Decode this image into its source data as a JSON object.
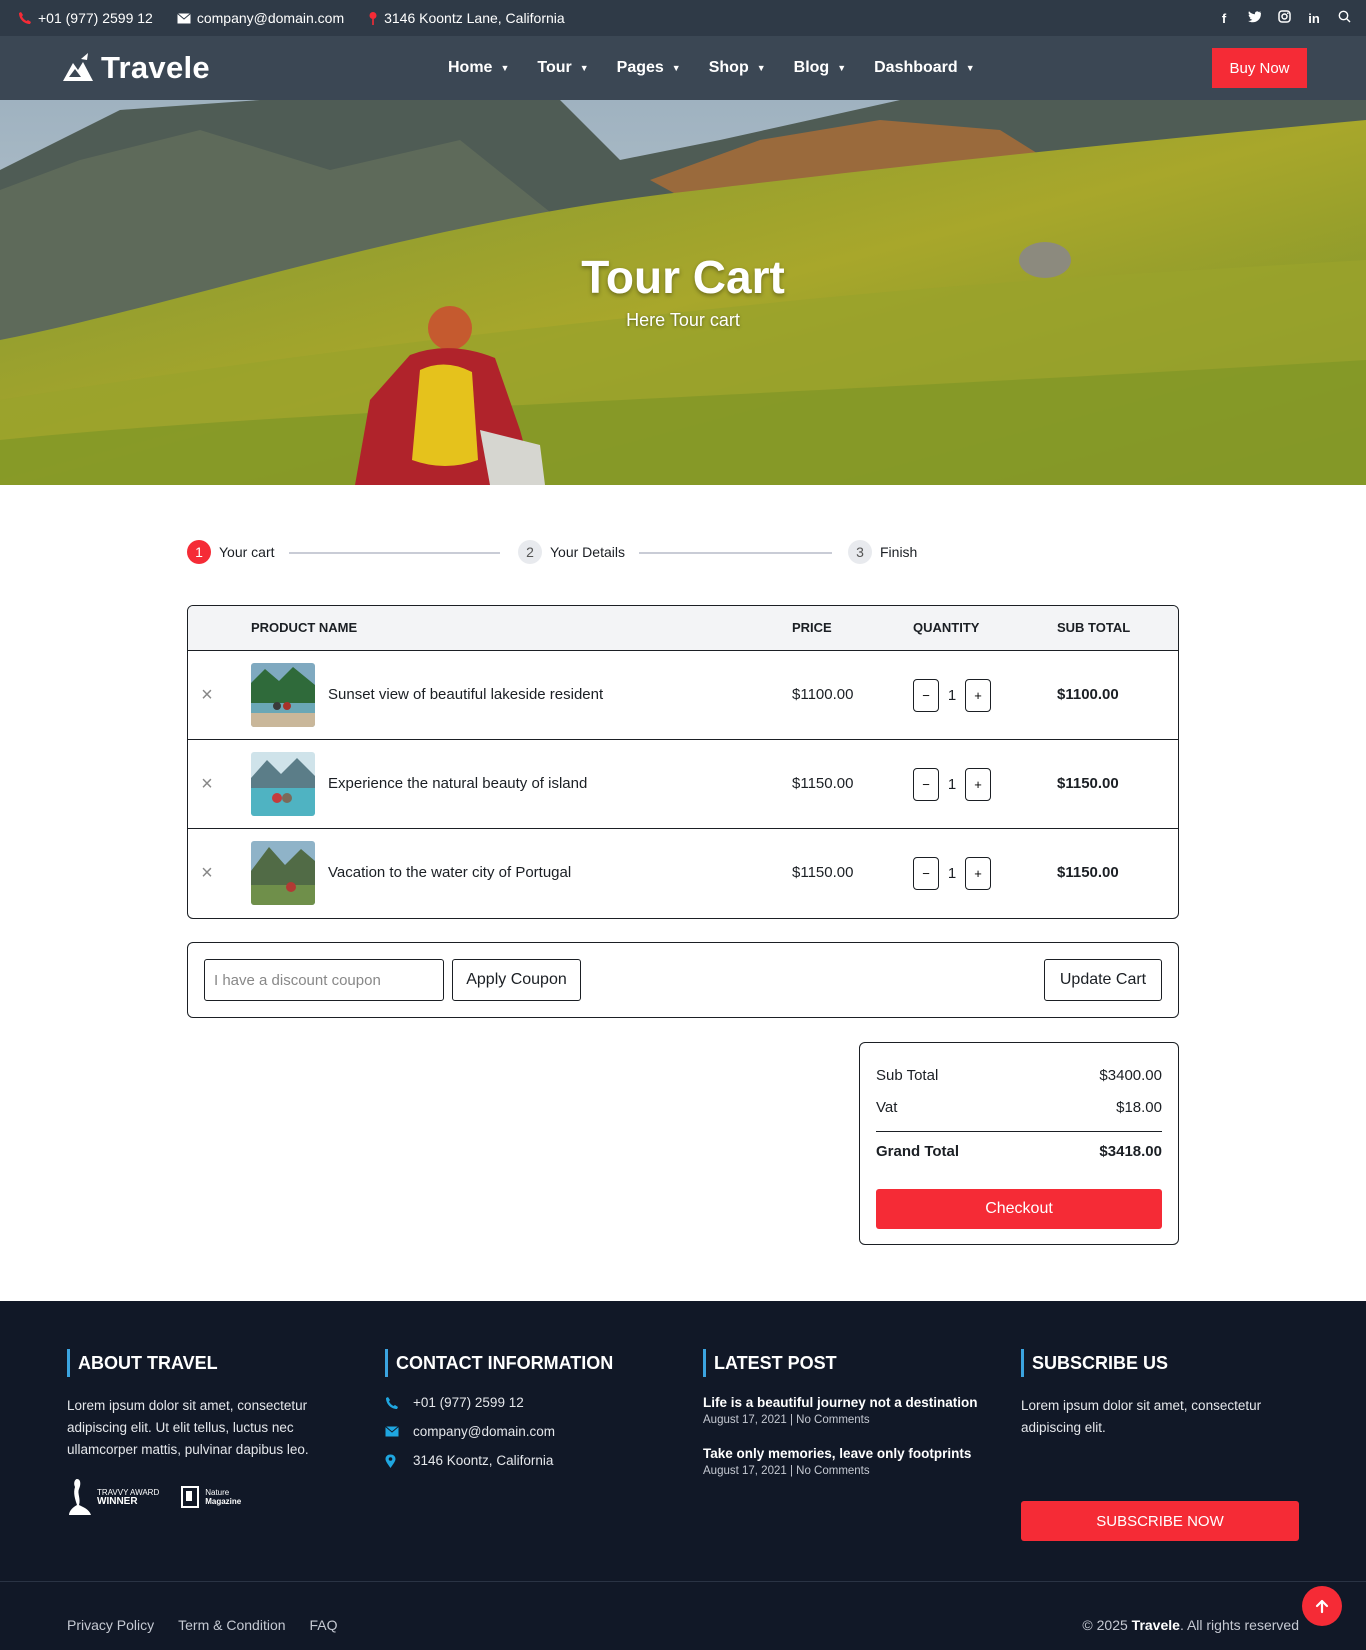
{
  "topbar": {
    "phone": "+01 (977) 2599 12",
    "email": "company@domain.com",
    "address": "3146 Koontz Lane, California",
    "social": [
      "facebook-icon",
      "twitter-icon",
      "instagram-icon",
      "linkedin-icon",
      "search-icon"
    ]
  },
  "navbar": {
    "logo": "Travele",
    "menu": [
      {
        "label": "Home"
      },
      {
        "label": "Tour"
      },
      {
        "label": "Pages"
      },
      {
        "label": "Shop"
      },
      {
        "label": "Blog"
      },
      {
        "label": "Dashboard"
      }
    ],
    "buy_label": "Buy Now"
  },
  "hero": {
    "title": "Tour Cart",
    "subtitle": "Here Tour cart"
  },
  "steps": [
    {
      "num": "1",
      "label": "Your cart",
      "active": true
    },
    {
      "num": "2",
      "label": "Your Details",
      "active": false
    },
    {
      "num": "3",
      "label": "Finish",
      "active": false
    }
  ],
  "cart": {
    "headers": {
      "product": "PRODUCT NAME",
      "price": "PRICE",
      "quantity": "QUANTITY",
      "subtotal": "SUB TOTAL"
    },
    "items": [
      {
        "name": "Sunset view of beautiful lakeside resident",
        "price": "$1100.00",
        "qty": "1",
        "subtotal": "$1100.00"
      },
      {
        "name": "Experience the natural beauty of island",
        "price": "$1150.00",
        "qty": "1",
        "subtotal": "$1150.00"
      },
      {
        "name": "Vacation to the water city of Portugal",
        "price": "$1150.00",
        "qty": "1",
        "subtotal": "$1150.00"
      }
    ],
    "minus": "−",
    "plus": "+"
  },
  "coupon": {
    "placeholder": "I have a discount coupon",
    "apply_label": "Apply Coupon",
    "update_label": "Update Cart"
  },
  "totals": {
    "subtotal_label": "Sub Total",
    "subtotal_value": "$3400.00",
    "vat_label": "Vat",
    "vat_value": "$18.00",
    "grand_label": "Grand Total",
    "grand_value": "$3418.00",
    "checkout_label": "Checkout"
  },
  "footer": {
    "about": {
      "title": "ABOUT TRAVEL",
      "text": "Lorem ipsum dolor sit amet, consectetur adipiscing elit. Ut elit tellus, luctus nec ullamcorper mattis, pulvinar dapibus leo.",
      "award1_top": "TRAVVY AWARD",
      "award1_bottom": "WINNER",
      "award2_top": "Nature",
      "award2_bottom": "Magazine"
    },
    "contact": {
      "title": "CONTACT INFORMATION",
      "phone": "+01 (977) 2599 12",
      "email": "company@domain.com",
      "address": "3146 Koontz, California"
    },
    "latest": {
      "title": "LATEST POST",
      "posts": [
        {
          "title": "Life is a beautiful journey not a destination",
          "meta": "August 17, 2021 | No Comments"
        },
        {
          "title": "Take only memories, leave only footprints",
          "meta": "August 17, 2021 | No Comments"
        }
      ]
    },
    "subscribe": {
      "title": "SUBSCRIBE US",
      "text": "Lorem ipsum dolor sit amet, consectetur adipiscing elit.",
      "button": "SUBSCRIBE NOW"
    },
    "links": [
      "Privacy Policy",
      "Term & Condition",
      "FAQ"
    ],
    "copyright_prefix": "© 2025 ",
    "copyright_brand": "Travele",
    "copyright_suffix": ". All rights reserved"
  },
  "colors": {
    "accent": "#f52b36",
    "topbar": "#2f3a47",
    "navbar": "#3b4754",
    "footer": "#111827",
    "footer_icon": "#1fa6e0"
  }
}
